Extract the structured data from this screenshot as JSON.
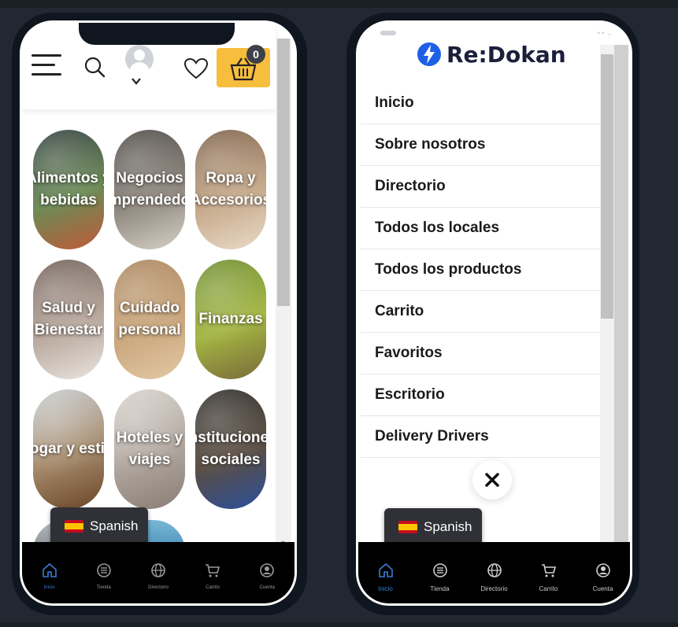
{
  "left_phone": {
    "cart_count": "0",
    "categories": [
      {
        "label": "Alimentos y bebidas",
        "icon": "food-image",
        "colors": [
          "#2d3b3a",
          "#6b8a55",
          "#c05a3a"
        ]
      },
      {
        "label": "Negocios Emprendedores",
        "icon": "lightbulbs-image",
        "colors": [
          "#4a4642",
          "#8c857c",
          "#d6d0c6"
        ]
      },
      {
        "label": "Ropa y Accesorios",
        "icon": "closet-image",
        "colors": [
          "#7a5c44",
          "#c5a889",
          "#eadbc8"
        ]
      },
      {
        "label": "Salud y Bienestar",
        "icon": "doctor-image",
        "colors": [
          "#6a5a52",
          "#b8a79b",
          "#e9e4df"
        ]
      },
      {
        "label": "Cuidado personal",
        "icon": "bamboo-brush-image",
        "colors": [
          "#a8835a",
          "#c9a57b",
          "#e2c9a5"
        ]
      },
      {
        "label": "Finanzas",
        "icon": "coins-plant-image",
        "colors": [
          "#6b8a2a",
          "#a4b642",
          "#7a6a3a"
        ]
      },
      {
        "label": "Hogar y estilo",
        "icon": "wood-table-image",
        "colors": [
          "#c8ccd2",
          "#a58a6a",
          "#6a4628"
        ]
      },
      {
        "label": "Hoteles y viajes",
        "icon": "suitcase-image",
        "colors": [
          "#d8d2cc",
          "#b0a69e",
          "#8a7e76"
        ]
      },
      {
        "label": "Instituciones sociales",
        "icon": "blue-door-image",
        "colors": [
          "#2c2a28",
          "#5a4e42",
          "#2b4f9a"
        ]
      }
    ],
    "language": "Spanish"
  },
  "right_phone": {
    "logo_text": "Re:Dokan",
    "menu": [
      "Inicio",
      "Sobre nosotros",
      "Directorio",
      "Todos los locales",
      "Todos los productos",
      "Carrito",
      "Favoritos",
      "Escritorio",
      "Delivery Drivers"
    ],
    "language": "Spanish"
  },
  "bottom_nav": [
    {
      "label": "Inicio",
      "icon": "home-icon"
    },
    {
      "label": "Tienda",
      "icon": "list-icon"
    },
    {
      "label": "Directorio",
      "icon": "globe-icon"
    },
    {
      "label": "Carrito",
      "icon": "cart-icon"
    },
    {
      "label": "Cuenta",
      "icon": "account-icon"
    }
  ],
  "colors": {
    "accent": "#f7bd3d",
    "active_nav": "#3a7bd5",
    "logo_blue": "#1f5fe8",
    "nav_background": "#000000",
    "page_background": "#222831"
  }
}
